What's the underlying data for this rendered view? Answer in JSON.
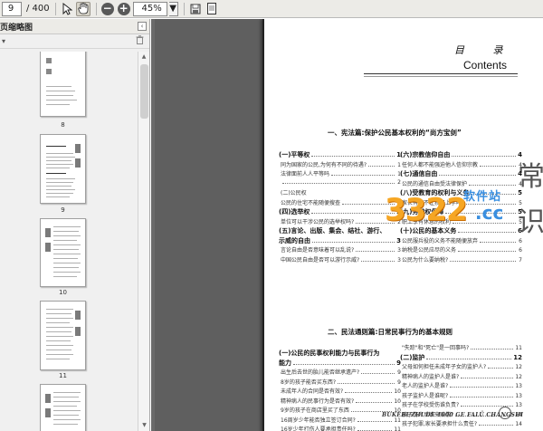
{
  "toolbar": {
    "page_current": "9",
    "page_total": "/ 400",
    "zoom_value": "45%",
    "icons": [
      "select-cursor-icon",
      "hand-tool-icon",
      "zoom-out-icon",
      "zoom-in-icon",
      "save-icon",
      "page-view-icon"
    ]
  },
  "left_panel": {
    "title": "页缩略图",
    "collapse_symbol": "‹",
    "options_symbol": "▾",
    "thumbnail_labels": [
      "8",
      "9",
      "10",
      "11"
    ]
  },
  "document": {
    "toc_title": "目 录",
    "toc_subtitle": "Contents",
    "side_chars": "常识",
    "footer_text": "BUKEBUZHI DE 1000 GE FALÜ CHANGSHI",
    "section1": {
      "title": "一、宪法篇:保护公民基本权利的“尚方宝剑”",
      "left": [
        {
          "text": "(一)平等权",
          "page": "1",
          "type": "h"
        },
        {
          "text": "同为国家的公民,为何有不同的待遇?",
          "page": "1",
          "type": "sub"
        },
        {
          "text": "法律面前人人平等吗",
          "page": "1",
          "type": "sub"
        },
        {
          "text": "",
          "page": "2",
          "type": "sub"
        },
        {
          "text": "(二)公民权",
          "page": "",
          "type": "sub"
        },
        {
          "text": "公民的住宅不能随便搜查",
          "page": "2",
          "type": "sub"
        },
        {
          "text": "(四)选举权",
          "page": "2",
          "type": "h"
        },
        {
          "text": "单位可以干涉公民的选举权吗?",
          "page": "2",
          "type": "sub"
        },
        {
          "text": "(五)言论、出版、集会、结社、游行、",
          "page": "",
          "type": "h"
        },
        {
          "text": "示威的自由",
          "page": "3",
          "type": "h"
        },
        {
          "text": "言论自由是否意味着可以乱说?",
          "page": "3",
          "type": "sub"
        },
        {
          "text": "中国公民自由是否可以游行示威?",
          "page": "3",
          "type": "sub"
        }
      ],
      "right": [
        {
          "text": "(六)宗教信仰自由",
          "page": "4",
          "type": "h"
        },
        {
          "text": "任何人都不能强迫他人信仰宗教",
          "page": "4",
          "type": "sub"
        },
        {
          "text": "(七)通信自由",
          "page": "4",
          "type": "h"
        },
        {
          "text": "公民的通信自由受法律保护",
          "page": "4",
          "type": "sub"
        },
        {
          "text": "(八)受教育的权利与义务",
          "page": "5",
          "type": "h"
        },
        {
          "text": "家长有权不让孩子上学吗?",
          "page": "5",
          "type": "sub"
        },
        {
          "text": "(九)劳动权保障",
          "page": "5",
          "type": "h"
        },
        {
          "text": "职工享有休息的权利",
          "page": "5",
          "type": "sub"
        },
        {
          "text": "(十)公民的基本义务",
          "page": "6",
          "type": "h"
        },
        {
          "text": "公民服兵役的义务不能随便放弃",
          "page": "6",
          "type": "sub"
        },
        {
          "text": "纳税是公民应尽的义务",
          "page": "6",
          "type": "sub"
        },
        {
          "text": "公民为什么要纳税?",
          "page": "7",
          "type": "sub"
        }
      ]
    },
    "section2": {
      "title": "二、民法通则篇:日常民事行为的基本规则",
      "left": [
        {
          "text": "(一)公民的民事权利能力与民事行为",
          "page": "",
          "type": "h"
        },
        {
          "text": "能力",
          "page": "9",
          "type": "h"
        },
        {
          "text": "出生后去世的胎儿能否继承遗产?",
          "page": "9",
          "type": "sub"
        },
        {
          "text": "8岁的孩子能否买东西?",
          "page": "9",
          "type": "sub"
        },
        {
          "text": "未成年人的合同是否有效?",
          "page": "10",
          "type": "sub"
        },
        {
          "text": "精神病人的民事行为是否有效?",
          "page": "10",
          "type": "sub"
        },
        {
          "text": "9岁的孩子在商店里买了东西",
          "page": "10",
          "type": "sub"
        },
        {
          "text": "16周岁少年能否独立签订合同?",
          "page": "11",
          "type": "sub"
        },
        {
          "text": "16岁少年打伤人要承担责任吗?",
          "page": "11",
          "type": "sub"
        }
      ],
      "right": [
        {
          "text": "\"失踪\"和\"死亡\"是一回事吗?",
          "page": "11",
          "type": "sub"
        },
        {
          "text": "(二)监护",
          "page": "12",
          "type": "h"
        },
        {
          "text": "父母如何担任未成年子女的监护人?",
          "page": "12",
          "type": "sub"
        },
        {
          "text": "精神病人的监护人是谁?",
          "page": "12",
          "type": "sub"
        },
        {
          "text": "老人的监护人是谁?",
          "page": "13",
          "type": "sub"
        },
        {
          "text": "孩子监护人是谁呢?",
          "page": "13",
          "type": "sub"
        },
        {
          "text": "孩子在学校受伤谁负责?",
          "page": "13",
          "type": "sub"
        },
        {
          "text": "孩子伤人后谁来赔偿?",
          "page": "14",
          "type": "sub"
        },
        {
          "text": "孩子犯罪,家长要承担什么责任?",
          "page": "14",
          "type": "sub"
        }
      ]
    },
    "watermark": {
      "brand": "3322",
      "cn": "软件站",
      "suffix": ".cc"
    }
  }
}
